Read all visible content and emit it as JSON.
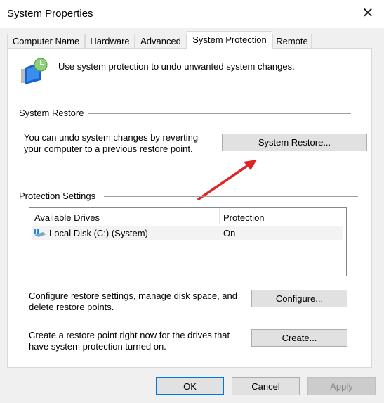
{
  "window": {
    "title": "System Properties",
    "close_icon": "close-icon"
  },
  "tabs": [
    {
      "label": "Computer Name"
    },
    {
      "label": "Hardware"
    },
    {
      "label": "Advanced"
    },
    {
      "label": "System Protection",
      "selected": true
    },
    {
      "label": "Remote"
    }
  ],
  "intro": {
    "icon": "system-protection-icon",
    "text": "Use system protection to undo unwanted system changes."
  },
  "restore": {
    "group_label": "System Restore",
    "text_line1": "You can undo system changes by reverting",
    "text_line2": "your computer to a previous restore point.",
    "button": "System Restore..."
  },
  "annotation": {
    "arrow_color": "#e02424"
  },
  "protection": {
    "group_label": "Protection Settings",
    "columns": [
      "Available Drives",
      "Protection"
    ],
    "rows": [
      {
        "drive": "Local Disk (C:) (System)",
        "protection": "On",
        "icon": "drive-icon"
      }
    ],
    "configure_text1": "Configure restore settings, manage disk space, and",
    "configure_text2": "delete restore points.",
    "configure_button": "Configure...",
    "create_text1": "Create a restore point right now for the drives that",
    "create_text2": "have system protection turned on.",
    "create_button": "Create..."
  },
  "footer": {
    "ok": "OK",
    "cancel": "Cancel",
    "apply": "Apply",
    "apply_disabled": true
  }
}
